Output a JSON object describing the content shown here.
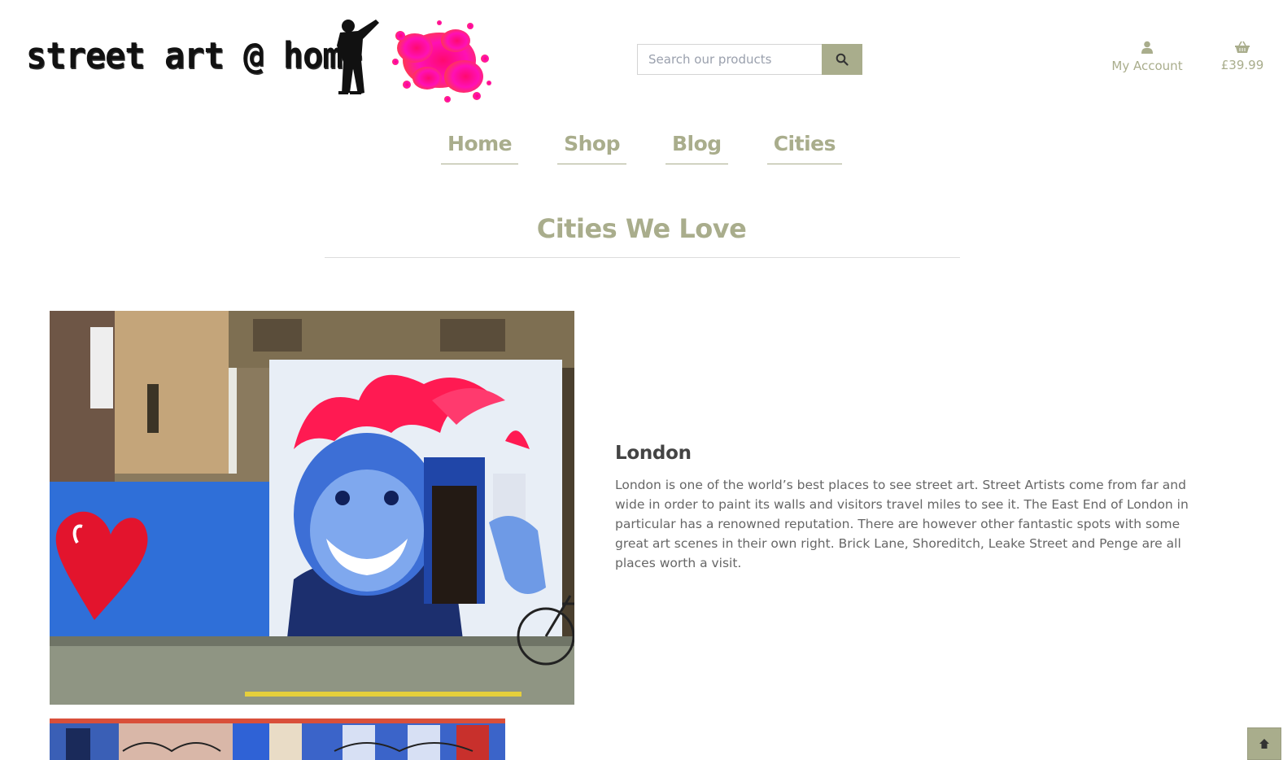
{
  "header": {
    "logo_text": "street art @ home",
    "search": {
      "placeholder": "Search our products",
      "value": ""
    },
    "account_label": "My Account",
    "cart_total": "£39.99"
  },
  "nav": {
    "items": [
      {
        "label": "Home"
      },
      {
        "label": "Shop"
      },
      {
        "label": "Blog"
      },
      {
        "label": "Cities"
      }
    ]
  },
  "main": {
    "title": "Cities We Love",
    "cities": [
      {
        "name": "London",
        "description": "London is one of the world’s best places to see street art. Street Artists come from far and wide in order to paint its walls and visitors travel miles to see it. The East End of London in particular has a renowned reputation. There are however other fantastic spots with some great art scenes in their own right. Brick Lane, Shoreditch, Leake Street and Penge are all places worth a visit."
      }
    ]
  },
  "icons": {
    "search": "search-icon",
    "account": "user-icon",
    "cart": "basket-icon",
    "back_to_top": "arrow-up-icon"
  },
  "colors": {
    "accent": "#a9ad8c",
    "text": "#555555",
    "splash": "#ff1493"
  }
}
